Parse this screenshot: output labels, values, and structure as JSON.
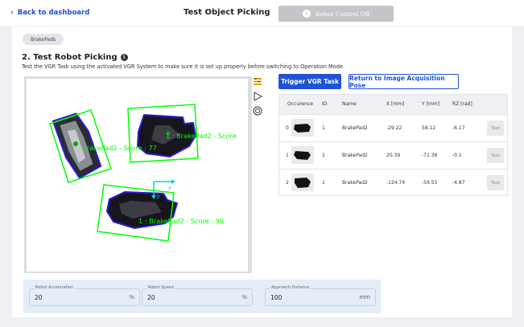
{
  "header": {
    "back_label": "Back to dashboard",
    "title": "Test Object Picking",
    "robot_status": "Robot Control Off"
  },
  "chip": "BrakePads",
  "section": {
    "title": "2. Test Robot Picking",
    "description": "Test the VGR Task using the activated VGR System to make sure it is set up properly before switching to Operation Mode."
  },
  "viewer": {
    "detections": [
      {
        "label": "BrakePad2 - Score : 77"
      },
      {
        "label": "1 : BrakePad2 - Score"
      },
      {
        "label": "1 : BrakePad2 - Score : 96"
      }
    ],
    "axis_x": "x",
    "axis_y": "y",
    "detection_color": "#00ff00",
    "axis_color": "#00d0e6"
  },
  "actions": {
    "trigger": "Trigger VGR Task",
    "return": "Return to Image Acquisition Pose"
  },
  "table": {
    "headers": [
      "Occurence",
      "ID",
      "Name",
      "X [mm]",
      "Y [mm]",
      "RZ [rad]"
    ],
    "rows": [
      {
        "occ": "0",
        "id": "1",
        "name": "BrakePad2",
        "x": "-29.22",
        "y": "58.12",
        "rz": "-6.17",
        "test": "Test"
      },
      {
        "occ": "1",
        "id": "1",
        "name": "BrakePad2",
        "x": "20.39",
        "y": "-71.38",
        "rz": "-0.1",
        "test": "Test"
      },
      {
        "occ": "2",
        "id": "1",
        "name": "BrakePad2",
        "x": "-124.74",
        "y": "-59.55",
        "rz": "-4.87",
        "test": "Test"
      }
    ]
  },
  "params": {
    "acceleration": {
      "label": "Robot Acceleration",
      "value": "20",
      "unit": "%"
    },
    "speed": {
      "label": "Robot Speed",
      "value": "20",
      "unit": "%"
    },
    "approach": {
      "label": "Approach Distance",
      "value": "100",
      "unit": "mm"
    }
  },
  "colors": {
    "accent": "#1e53d8",
    "disabled": "#c3c5c9"
  },
  "icons": [
    "chevron-left-icon",
    "info-icon",
    "layers-icon",
    "play-icon",
    "target-icon"
  ]
}
